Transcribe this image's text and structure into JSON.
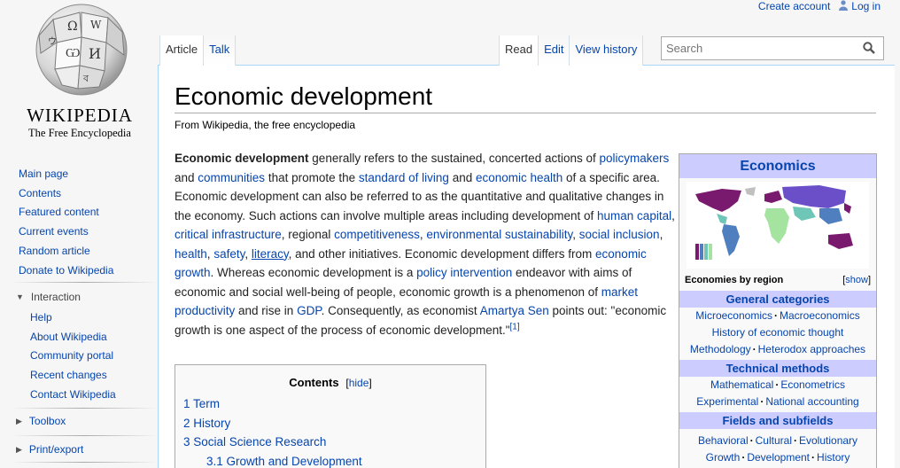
{
  "personal": {
    "create_account": "Create account",
    "login": "Log in"
  },
  "logo": {
    "wordmark": "WIKIPEDIA",
    "tagline": "The Free Encyclopedia"
  },
  "sidebar": {
    "nav": [
      "Main page",
      "Contents",
      "Featured content",
      "Current events",
      "Random article",
      "Donate to Wikipedia"
    ],
    "interaction_heading": "Interaction",
    "interaction": [
      "Help",
      "About Wikipedia",
      "Community portal",
      "Recent changes",
      "Contact Wikipedia"
    ],
    "toolbox_heading": "Toolbox",
    "print_heading": "Print/export"
  },
  "tabs": {
    "left": [
      "Article",
      "Talk"
    ],
    "right": [
      "Read",
      "Edit",
      "View history"
    ]
  },
  "search": {
    "placeholder": "Search"
  },
  "article": {
    "title": "Economic development",
    "tagline": "From Wikipedia, the free encyclopedia",
    "lead": [
      {
        "t": "Economic development",
        "b": true
      },
      {
        "t": " generally refers to the sustained, concerted actions of "
      },
      {
        "t": "policymakers",
        "link": true
      },
      {
        "t": " and "
      },
      {
        "t": "communities",
        "link": true
      },
      {
        "t": " that promote the "
      },
      {
        "t": "standard of living",
        "link": true
      },
      {
        "t": " and "
      },
      {
        "t": "economic health",
        "link": true
      },
      {
        "t": " of a specific area. Economic development can also be referred to as the quantitative and qualitative changes in the economy. Such actions can involve multiple areas including development of "
      },
      {
        "t": "human capital",
        "link": true
      },
      {
        "t": ", "
      },
      {
        "t": "critical infrastructure",
        "link": true
      },
      {
        "t": ", regional "
      },
      {
        "t": "competitiveness",
        "link": true
      },
      {
        "t": ", "
      },
      {
        "t": "environmental sustainability",
        "link": true
      },
      {
        "t": ", "
      },
      {
        "t": "social inclusion",
        "link": true
      },
      {
        "t": ", "
      },
      {
        "t": "health",
        "link": true
      },
      {
        "t": ", "
      },
      {
        "t": "safety",
        "link": true
      },
      {
        "t": ", "
      },
      {
        "t": "literacy",
        "link": true,
        "u": true
      },
      {
        "t": ", and other initiatives. Economic development differs from "
      },
      {
        "t": "economic growth",
        "link": true
      },
      {
        "t": ". Whereas economic development is a "
      },
      {
        "t": "policy intervention",
        "link": true
      },
      {
        "t": " endeavor with aims of economic and social well-being of people, economic growth is a phenomenon of "
      },
      {
        "t": "market productivity",
        "link": true
      },
      {
        "t": " and rise in "
      },
      {
        "t": "GDP",
        "link": true
      },
      {
        "t": ". Consequently, as economist "
      },
      {
        "t": "Amartya Sen",
        "link": true
      },
      {
        "t": " points out: \"economic growth is one aspect of the process of economic development.\""
      },
      {
        "t": "[1]",
        "link": true,
        "ref": true
      }
    ]
  },
  "toc": {
    "title": "Contents",
    "hide": "hide",
    "items": [
      {
        "label": "1 Term",
        "sub": false
      },
      {
        "label": "2 History",
        "sub": false
      },
      {
        "label": "3 Social Science Research",
        "sub": false
      },
      {
        "label": "3.1 Growth and Development",
        "sub": true
      }
    ]
  },
  "infobox": {
    "title": "Economics",
    "caption": "Economies by region",
    "show": "show",
    "sections": [
      {
        "heading": "General categories",
        "rows": [
          [
            "Microeconomics",
            "Macroeconomics"
          ],
          [
            "History of economic thought"
          ],
          [
            "Methodology",
            "Heterodox approaches"
          ]
        ]
      },
      {
        "heading": "Technical methods",
        "rows": [
          [
            "Mathematical",
            "Econometrics"
          ],
          [
            "Experimental",
            "National accounting"
          ]
        ]
      },
      {
        "heading": "Fields and subfields",
        "rows": [
          [
            "Behavioral",
            "Cultural",
            "Evolutionary"
          ],
          [
            "Growth",
            "Development",
            "History"
          ]
        ]
      }
    ],
    "map_colors": [
      "#7a1a6e",
      "#c0c0c0",
      "#4f7fbf",
      "#6ec6b7",
      "#a5e3a0",
      "#b2b2b2"
    ]
  }
}
